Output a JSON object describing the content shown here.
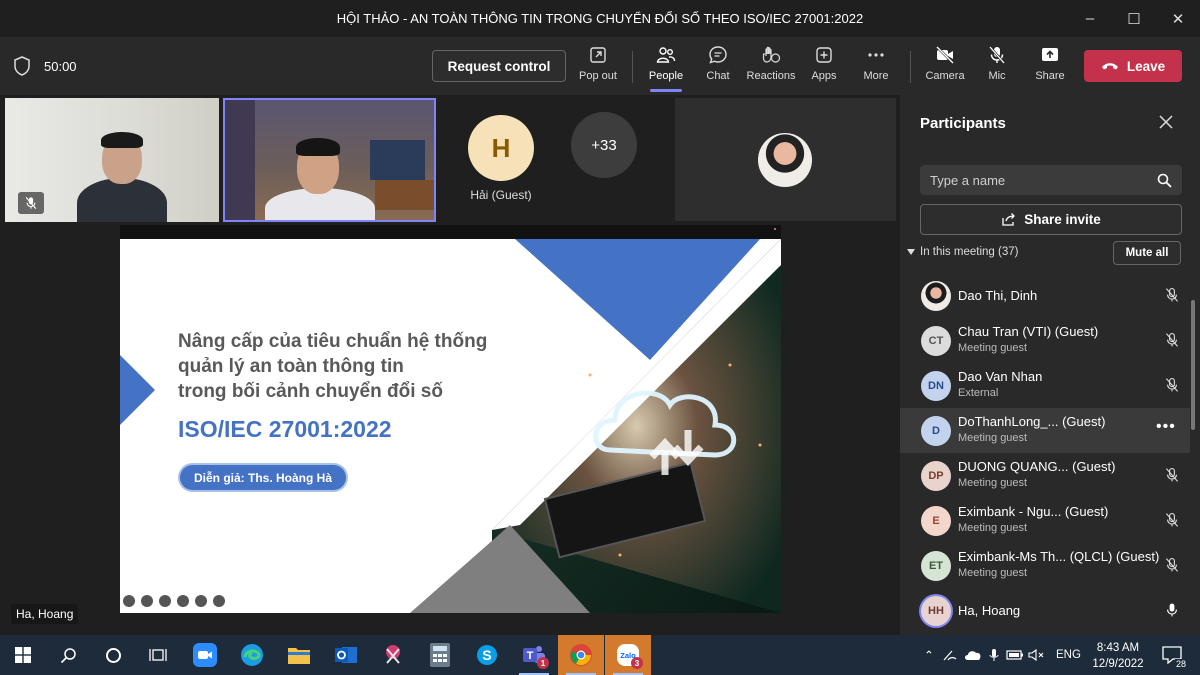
{
  "window": {
    "title": "HỘI THẢO - AN TOÀN THÔNG TIN TRONG CHUYỂN ĐỔI SỐ THEO ISO/IEC 27001:2022"
  },
  "toolbar": {
    "timer": "50:00",
    "request_control": "Request control",
    "items": [
      {
        "label": "Pop out",
        "icon": "pop-out-icon"
      },
      {
        "label": "People",
        "icon": "people-icon"
      },
      {
        "label": "Chat",
        "icon": "chat-icon"
      },
      {
        "label": "Reactions",
        "icon": "reactions-icon"
      },
      {
        "label": "Apps",
        "icon": "apps-icon"
      },
      {
        "label": "More",
        "icon": "more-icon"
      },
      {
        "label": "Camera",
        "icon": "camera-off-icon"
      },
      {
        "label": "Mic",
        "icon": "mic-off-icon"
      },
      {
        "label": "Share",
        "icon": "share-icon"
      }
    ],
    "leave": "Leave"
  },
  "stage": {
    "guest_initial": "H",
    "guest_name": "Hải (Guest)",
    "more_count": "+33",
    "presenter_name": "Ha, Hoang"
  },
  "slide": {
    "title_lines": [
      "Nâng cấp của tiêu chuẩn hệ thống",
      "quản lý an toàn thông tin",
      "trong bối cảnh chuyển đổi số"
    ],
    "standard": "ISO/IEC 27001:2022",
    "speaker": "Diễn giả: Ths. Hoàng Hà",
    "accent_color": "#4472c4"
  },
  "participants": {
    "title": "Participants",
    "search_placeholder": "Type a name",
    "share_invite": "Share invite",
    "section_label": "In this meeting (37)",
    "mute_all": "Mute all",
    "list": [
      {
        "initials": "",
        "name": "Dao Thi, Dinh",
        "sub": "",
        "mic": "mic-off-icon"
      },
      {
        "initials": "CT",
        "name": "Chau Tran (VTI) (Guest)",
        "sub": "Meeting guest",
        "mic": "mic-off-icon"
      },
      {
        "initials": "DN",
        "name": "Dao Van Nhan",
        "sub": "External",
        "mic": "mic-off-icon"
      },
      {
        "initials": "D",
        "name": "DoThanhLong_...     (Guest)",
        "sub": "Meeting guest",
        "mic": "more-options-icon"
      },
      {
        "initials": "DP",
        "name": "DUONG QUANG... (Guest)",
        "sub": "Meeting guest",
        "mic": "mic-off-icon"
      },
      {
        "initials": "E",
        "name": "Eximbank - Ngu...  (Guest)",
        "sub": "Meeting guest",
        "mic": "mic-off-icon"
      },
      {
        "initials": "ET",
        "name": "Eximbank-Ms Th... (QLCL) (Guest)",
        "sub": "Meeting guest",
        "mic": "mic-off-icon"
      },
      {
        "initials": "HH",
        "name": "Ha, Hoang",
        "sub": "",
        "mic": "mic-on-icon"
      }
    ]
  },
  "taskbar": {
    "language": "ENG",
    "time": "8:43 AM",
    "date": "12/9/2022",
    "notifications": "28",
    "teams_badge": "1",
    "zalo_badge": "3"
  }
}
